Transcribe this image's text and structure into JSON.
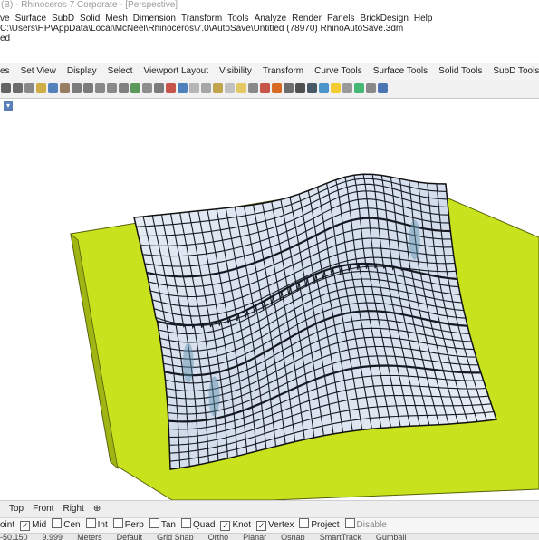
{
  "window": {
    "title": "(B) - Rhinoceros 7 Corporate - [Perspective]"
  },
  "menu": [
    "ve",
    "Surface",
    "SubD",
    "Solid",
    "Mesh",
    "Dimension",
    "Transform",
    "Tools",
    "Analyze",
    "Render",
    "Panels",
    "BrickDesign",
    "Help"
  ],
  "command_history": {
    "line1": "C:\\Users\\HP\\AppData\\Local\\McNeel\\Rhinoceros\\7.0\\AutoSave\\Untitled (78970) RhinoAutoSave.3dm",
    "line2": "ed"
  },
  "toolbar_tabs": [
    "es",
    "Set View",
    "Display",
    "Select",
    "Viewport Layout",
    "Visibility",
    "Transform",
    "Curve Tools",
    "Surface Tools",
    "Solid Tools",
    "SubD Tools"
  ],
  "toolbar_icons": [
    {
      "name": "undo-icon",
      "color": "#4a4a4a"
    },
    {
      "name": "cut-icon",
      "color": "#555"
    },
    {
      "name": "copy-icon",
      "color": "#777"
    },
    {
      "name": "paste-icon",
      "color": "#c9a227"
    },
    {
      "name": "undo-arrow-icon",
      "color": "#3a6fb0"
    },
    {
      "name": "pan-hand-icon",
      "color": "#8a6a4a"
    },
    {
      "name": "rotate-icon",
      "color": "#666"
    },
    {
      "name": "zoom-in-icon",
      "color": "#666"
    },
    {
      "name": "zoom-window-icon",
      "color": "#777"
    },
    {
      "name": "zoom-extents-icon",
      "color": "#777"
    },
    {
      "name": "zoom-selected-icon",
      "color": "#6c6c6c"
    },
    {
      "name": "set-cplane-icon",
      "color": "#3f8a3f"
    },
    {
      "name": "grid-icon",
      "color": "#7d7d7d"
    },
    {
      "name": "four-viewports-icon",
      "color": "#666"
    },
    {
      "name": "select-icon",
      "color": "#c0392b"
    },
    {
      "name": "layer-icon",
      "color": "#2f6db5"
    },
    {
      "name": "select-all-icon",
      "color": "#aaa"
    },
    {
      "name": "hide-icon",
      "color": "#999"
    },
    {
      "name": "lock-icon",
      "color": "#b8962e"
    },
    {
      "name": "show-icon",
      "color": "#b9b9b9"
    },
    {
      "name": "light-bulb-icon",
      "color": "#e0c14a"
    },
    {
      "name": "object-properties-icon",
      "color": "#777"
    },
    {
      "name": "material-icon",
      "color": "#c0392b"
    },
    {
      "name": "color-wheel-icon",
      "color": "#d35400"
    },
    {
      "name": "rendered-sphere-icon",
      "color": "#555"
    },
    {
      "name": "shaded-sphere-icon",
      "color": "#333"
    },
    {
      "name": "render-sphere-icon",
      "color": "#2c3e50"
    },
    {
      "name": "environment-icon",
      "color": "#2e86c1"
    },
    {
      "name": "sun-icon",
      "color": "#f1c40f"
    },
    {
      "name": "ground-plane-icon",
      "color": "#8a8a8a"
    },
    {
      "name": "tools-icon",
      "color": "#27ae60"
    },
    {
      "name": "options-icon",
      "color": "#777"
    },
    {
      "name": "help-icon",
      "color": "#2e5fa8"
    }
  ],
  "viewport_tabs": [
    "",
    "Top",
    "Front",
    "Right",
    "⊕"
  ],
  "osnaps": [
    {
      "label": "oint",
      "checked": false,
      "enabled": true
    },
    {
      "label": "Mid",
      "checked": true,
      "enabled": true
    },
    {
      "label": "Cen",
      "checked": false,
      "enabled": true
    },
    {
      "label": "Int",
      "checked": false,
      "enabled": true
    },
    {
      "label": "Perp",
      "checked": false,
      "enabled": true
    },
    {
      "label": "Tan",
      "checked": false,
      "enabled": true
    },
    {
      "label": "Quad",
      "checked": false,
      "enabled": true
    },
    {
      "label": "Knot",
      "checked": true,
      "enabled": true
    },
    {
      "label": "Vertex",
      "checked": true,
      "enabled": true
    },
    {
      "label": "Project",
      "checked": false,
      "enabled": true
    },
    {
      "label": "Disable",
      "checked": false,
      "enabled": false
    }
  ],
  "status_bar": [
    "-50.150",
    "9.999",
    "Meters",
    "Default",
    "Grid Snap",
    "Ortho",
    "Planar",
    "Osnap",
    "SmartTrack",
    "Gumball"
  ],
  "scene": {
    "ground_color": "#c8e21e",
    "surface_line_color": "#151a22",
    "glass_color": "#dbe6f2"
  }
}
